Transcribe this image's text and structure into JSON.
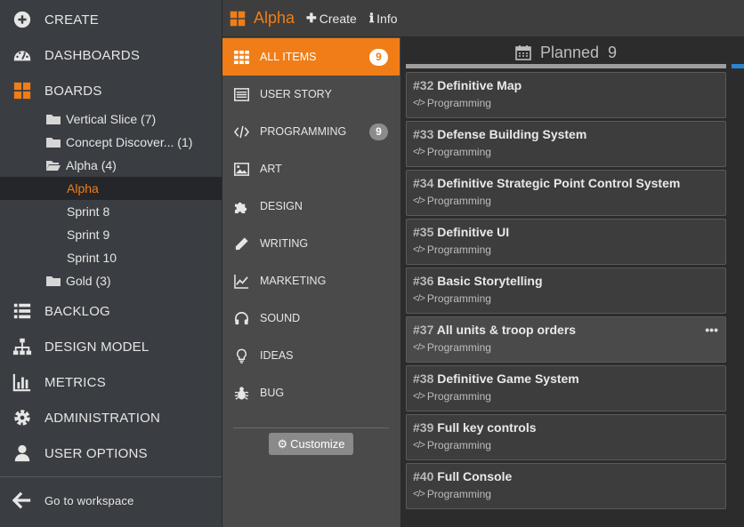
{
  "nav": {
    "create": "CREATE",
    "dashboards": "DASHBOARDS",
    "boards": "BOARDS",
    "tree": [
      {
        "label": "Vertical Slice (7)"
      },
      {
        "label": "Concept Discover... (1)"
      },
      {
        "label": "Alpha (4)"
      },
      {
        "label": "Alpha"
      },
      {
        "label": "Sprint 8"
      },
      {
        "label": "Sprint 9"
      },
      {
        "label": "Sprint 10"
      },
      {
        "label": "Gold (3)"
      }
    ],
    "backlog": "BACKLOG",
    "design_model": "DESIGN MODEL",
    "metrics": "METRICS",
    "administration": "ADMINISTRATION",
    "user_options": "USER OPTIONS",
    "workspace": "Go to workspace"
  },
  "topbar": {
    "title": "Alpha",
    "create": "Create",
    "info": "Info"
  },
  "categories": [
    {
      "label": "ALL ITEMS",
      "badge": "9"
    },
    {
      "label": "USER STORY"
    },
    {
      "label": "PROGRAMMING",
      "badge": "9"
    },
    {
      "label": "ART"
    },
    {
      "label": "DESIGN"
    },
    {
      "label": "WRITING"
    },
    {
      "label": "MARKETING"
    },
    {
      "label": "SOUND"
    },
    {
      "label": "IDEAS"
    },
    {
      "label": "BUG"
    }
  ],
  "customize": "Customize",
  "column": {
    "title": "Planned",
    "count": "9"
  },
  "cards": [
    {
      "num": "#32",
      "title": "Definitive Map",
      "tag": "Programming"
    },
    {
      "num": "#33",
      "title": "Defense Building System",
      "tag": "Programming"
    },
    {
      "num": "#34",
      "title": "Definitive Strategic Point Control System",
      "tag": "Programming"
    },
    {
      "num": "#35",
      "title": "Definitive UI",
      "tag": "Programming"
    },
    {
      "num": "#36",
      "title": "Basic Storytelling",
      "tag": "Programming"
    },
    {
      "num": "#37",
      "title": "All units & troop orders",
      "tag": "Programming",
      "menu": "•••"
    },
    {
      "num": "#38",
      "title": "Definitive Game System",
      "tag": "Programming"
    },
    {
      "num": "#39",
      "title": "Full key controls",
      "tag": "Programming"
    },
    {
      "num": "#40",
      "title": "Full Console",
      "tag": "Programming"
    }
  ],
  "colors": {
    "accent": "#f07d17",
    "nav_bg": "#3a3d42",
    "mid_bg": "#4a4a4a",
    "board_bg": "#2c2c2c",
    "next_column": "#2d83cf"
  }
}
